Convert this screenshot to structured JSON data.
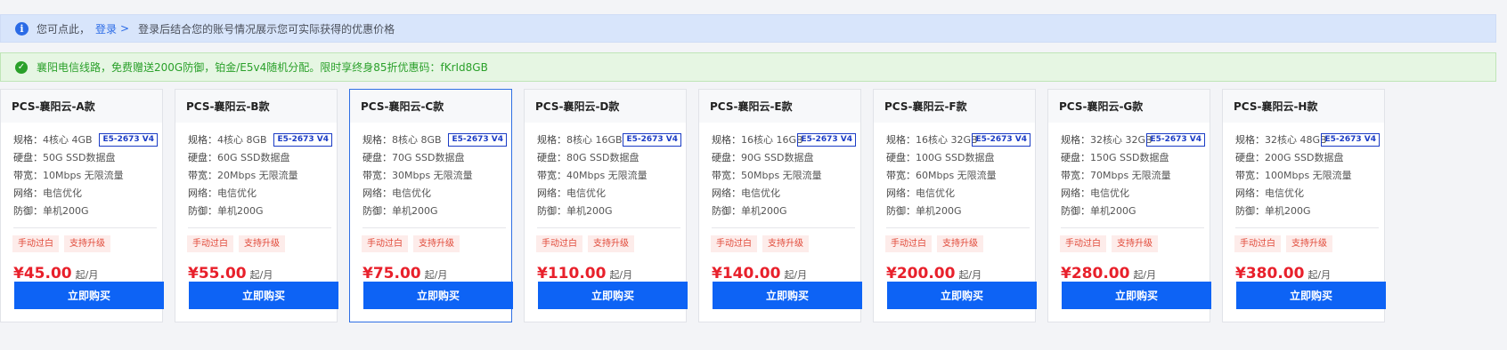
{
  "notice": {
    "prefix": "您可点此，",
    "login_link": "登录",
    "chevron": ">",
    "message": "登录后结合您的账号情况展示您可实际获得的优惠价格"
  },
  "promo": {
    "message": "襄阳电信线路，免费赠送200G防御，铂金/E5v4随机分配。限时享终身85折优惠码：fKrId8GB"
  },
  "labels": {
    "spec": "规格：",
    "disk": "硬盘：",
    "bandwidth": "带宽：",
    "network": "网络：",
    "defense": "防御：",
    "unit": "起/月",
    "buy": "立即购买"
  },
  "products": [
    {
      "name": "PCS-襄阳云-A款",
      "spec": "4核心 4GB",
      "cpu": "E5-2673 V4",
      "disk": "50G SSD数据盘",
      "bandwidth": "10Mbps 无限流量",
      "network": "电信优化",
      "defense": "单机200G",
      "tags": [
        "手动过白",
        "支持升级"
      ],
      "price": "¥45.00"
    },
    {
      "name": "PCS-襄阳云-B款",
      "spec": "4核心 8GB",
      "cpu": "E5-2673 V4",
      "disk": "60G SSD数据盘",
      "bandwidth": "20Mbps 无限流量",
      "network": "电信优化",
      "defense": "单机200G",
      "tags": [
        "手动过白",
        "支持升级"
      ],
      "price": "¥55.00"
    },
    {
      "name": "PCS-襄阳云-C款",
      "spec": "8核心 8GB",
      "cpu": "E5-2673 V4",
      "disk": "70G SSD数据盘",
      "bandwidth": "30Mbps 无限流量",
      "network": "电信优化",
      "defense": "单机200G",
      "tags": [
        "手动过白",
        "支持升级"
      ],
      "price": "¥75.00"
    },
    {
      "name": "PCS-襄阳云-D款",
      "spec": "8核心 16GB",
      "cpu": "E5-2673 V4",
      "disk": "80G SSD数据盘",
      "bandwidth": "40Mbps 无限流量",
      "network": "电信优化",
      "defense": "单机200G",
      "tags": [
        "手动过白",
        "支持升级"
      ],
      "price": "¥110.00"
    },
    {
      "name": "PCS-襄阳云-E款",
      "spec": "16核心 16GB",
      "cpu": "E5-2673 V4",
      "disk": "90G SSD数据盘",
      "bandwidth": "50Mbps 无限流量",
      "network": "电信优化",
      "defense": "单机200G",
      "tags": [
        "手动过白",
        "支持升级"
      ],
      "price": "¥140.00"
    },
    {
      "name": "PCS-襄阳云-F款",
      "spec": "16核心 32GB",
      "cpu": "E5-2673 V4",
      "disk": "100G SSD数据盘",
      "bandwidth": "60Mbps 无限流量",
      "network": "电信优化",
      "defense": "单机200G",
      "tags": [
        "手动过白",
        "支持升级"
      ],
      "price": "¥200.00"
    },
    {
      "name": "PCS-襄阳云-G款",
      "spec": "32核心 32GB",
      "cpu": "E5-2673 V4",
      "disk": "150G SSD数据盘",
      "bandwidth": "70Mbps 无限流量",
      "network": "电信优化",
      "defense": "单机200G",
      "tags": [
        "手动过白",
        "支持升级"
      ],
      "price": "¥280.00"
    },
    {
      "name": "PCS-襄阳云-H款",
      "spec": "32核心 48GB",
      "cpu": "E5-2673 V4",
      "disk": "200G SSD数据盘",
      "bandwidth": "100Mbps 无限流量",
      "network": "电信优化",
      "defense": "单机200G",
      "tags": [
        "手动过白",
        "支持升级"
      ],
      "price": "¥380.00"
    }
  ]
}
